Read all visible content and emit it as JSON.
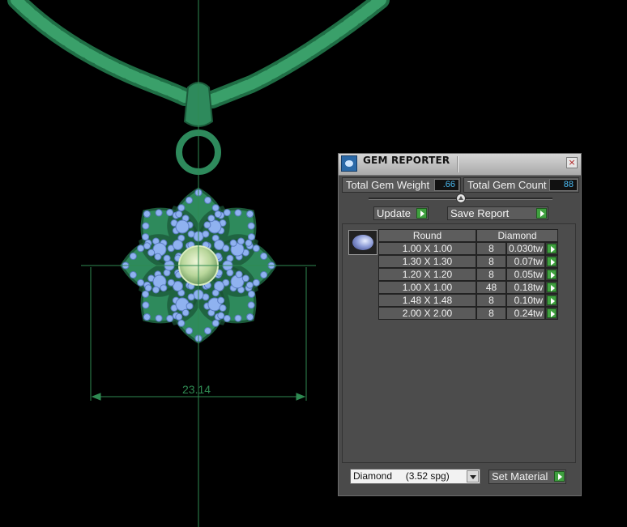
{
  "viewport": {
    "dimension_label": "23.14",
    "icons": [
      "pendant-model",
      "chain-model",
      "dimension-line"
    ]
  },
  "panel": {
    "title": "GEM REPORTER",
    "close_label": "×",
    "total_weight_label": "Total Gem Weight",
    "total_weight_value": ".66",
    "total_count_label": "Total Gem Count",
    "total_count_value": "88",
    "update_label": "Update",
    "save_report_label": "Save Report",
    "table": {
      "shape_header": "Round",
      "material_header": "Diamond",
      "rows": [
        {
          "size": "1.00 X 1.00",
          "count": "8",
          "weight": "0.030tw"
        },
        {
          "size": "1.30 X 1.30",
          "count": "8",
          "weight": "0.07tw"
        },
        {
          "size": "1.20 X 1.20",
          "count": "8",
          "weight": "0.05tw"
        },
        {
          "size": "1.00 X 1.00",
          "count": "48",
          "weight": "0.18tw"
        },
        {
          "size": "1.48 X 1.48",
          "count": "8",
          "weight": "0.10tw"
        },
        {
          "size": "2.00 X 2.00",
          "count": "8",
          "weight": "0.24tw"
        }
      ]
    },
    "material_value": "Diamond     (3.52 spg)",
    "set_material_label": "Set Material"
  },
  "colors": {
    "model_green": "#2e8a5c",
    "gem_blue": "#8fb2f0",
    "value_text": "#49b8ef",
    "button_arrow": "#3fa03f"
  }
}
